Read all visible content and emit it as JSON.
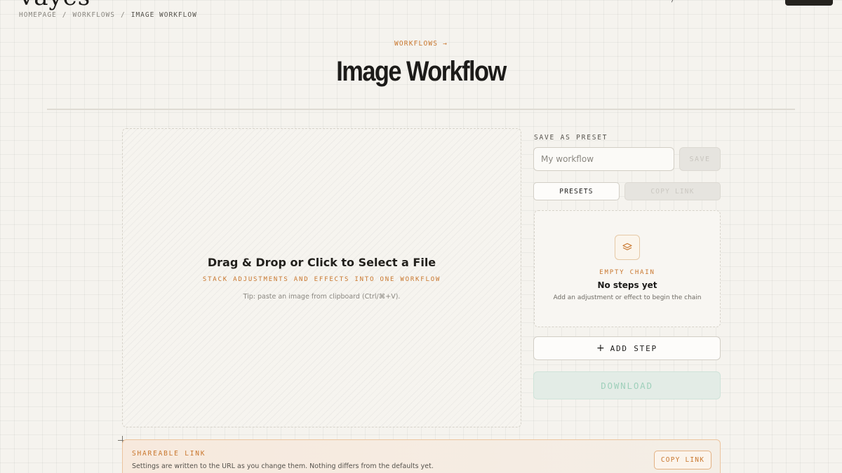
{
  "header": {
    "logo": "vayes",
    "action_glyph": ")"
  },
  "breadcrumb": [
    {
      "label": "HOMEPAGE"
    },
    {
      "label": "/"
    },
    {
      "label": "WORKFLOWS"
    },
    {
      "label": "/"
    },
    {
      "label": "IMAGE WORKFLOW"
    }
  ],
  "hero": {
    "eyebrow": "WORKFLOWS →",
    "title": "Image Workflow"
  },
  "dropzone": {
    "title": "Drag & Drop or Click to Select a File",
    "subtitle": "STACK ADJUSTMENTS AND EFFECTS INTO ONE WORKFLOW",
    "tip": "Tip: paste an image from clipboard (Ctrl/⌘+V)."
  },
  "preset": {
    "label": "SAVE AS PRESET",
    "placeholder": "My workflow",
    "save_label": "SAVE",
    "presets_label": "PRESETS",
    "copy_link_label": "COPY LINK"
  },
  "chain": {
    "icon": "layers-icon",
    "eyebrow": "EMPTY CHAIN",
    "title": "No steps yet",
    "subtitle": "Add an adjustment or effect to begin the chain"
  },
  "actions": {
    "add_step_icon": "+",
    "add_step_label": "ADD STEP",
    "download_label": "DOWNLOAD"
  },
  "share": {
    "label": "SHAREABLE LINK",
    "description": "Settings are written to the URL as you change them. Nothing differs from the defaults yet.",
    "copy_label": "COPY LINK"
  },
  "colors": {
    "accent": "#c9772e",
    "background": "#f5f3ee",
    "download_text": "#9fd0bb"
  }
}
